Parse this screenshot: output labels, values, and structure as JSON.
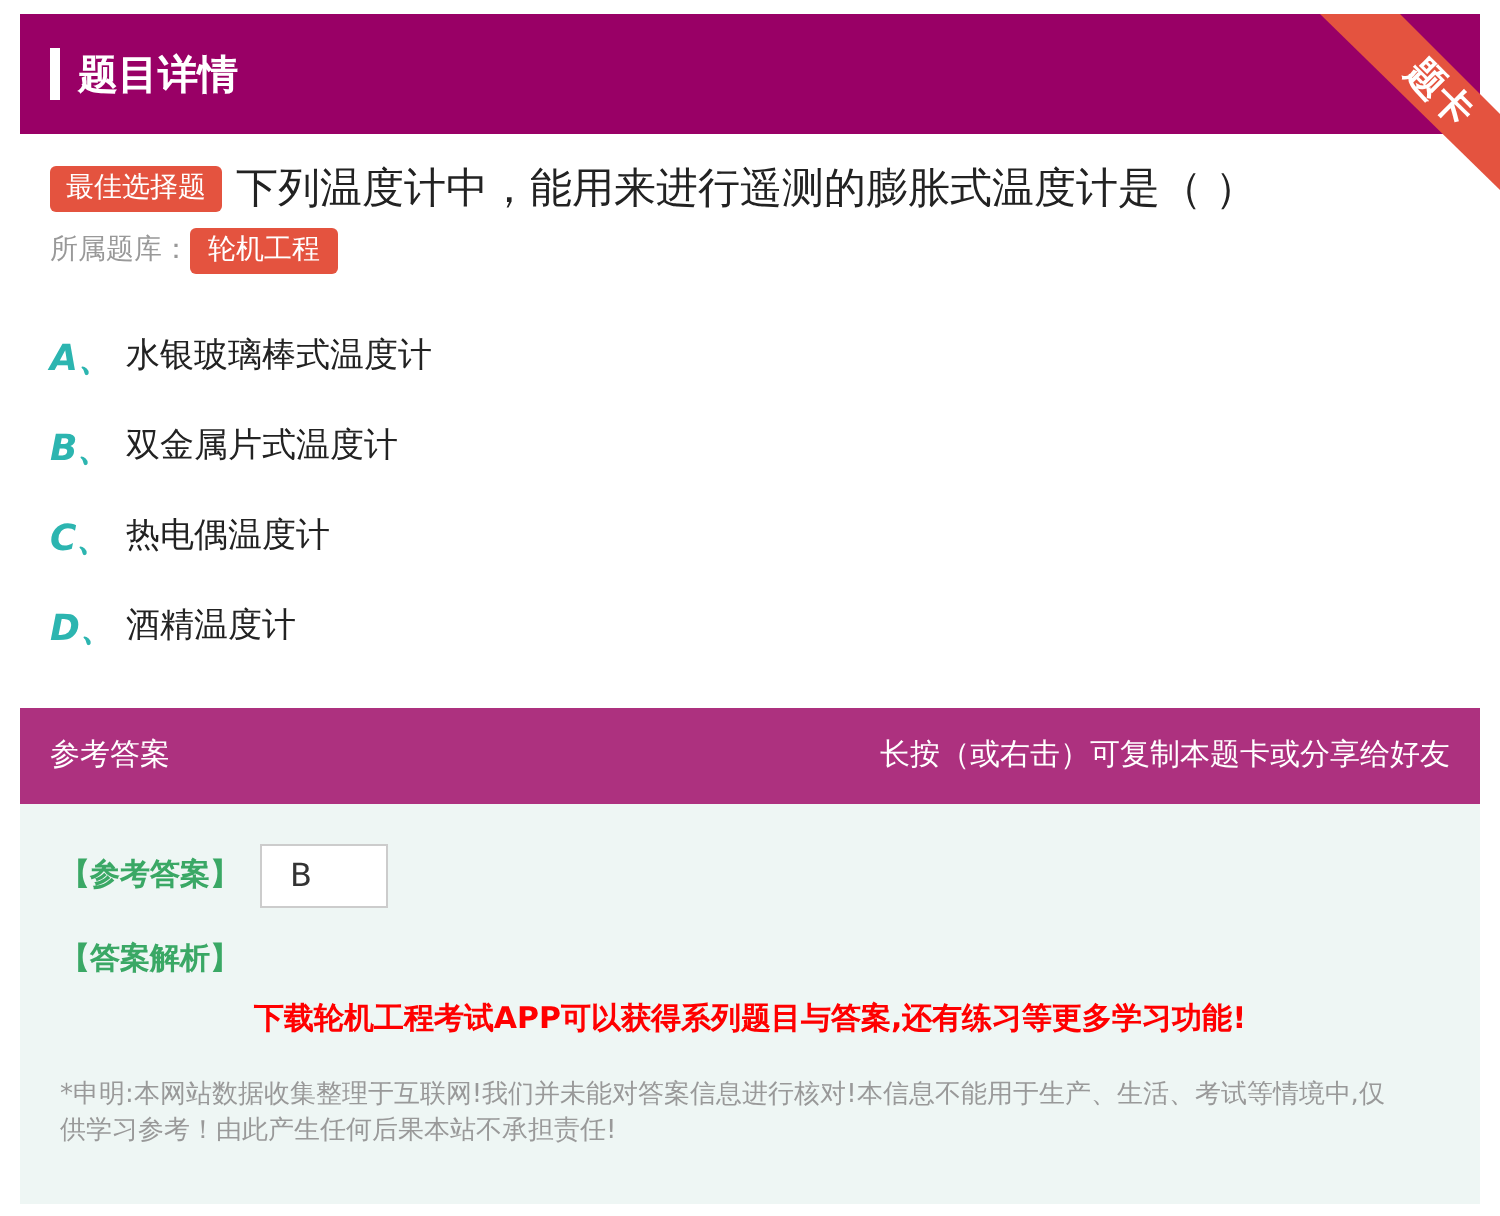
{
  "header": {
    "title": "题目详情",
    "corner_ribbon": "题卡"
  },
  "question": {
    "type_badge": "最佳选择题",
    "text": "下列温度计中，能用来进行遥测的膨胀式温度计是（ ）",
    "bank_label": "所属题库：",
    "bank_badge": "轮机工程"
  },
  "options": [
    {
      "label": "A、",
      "text": "水银玻璃棒式温度计"
    },
    {
      "label": "B、",
      "text": "双金属片式温度计"
    },
    {
      "label": "C、",
      "text": "热电偶温度计"
    },
    {
      "label": "D、",
      "text": "酒精温度计"
    }
  ],
  "answer_bar": {
    "title": "参考答案",
    "hint": "长按（或右击）可复制本题卡或分享给好友"
  },
  "answer": {
    "answer_label": "【参考答案】",
    "answer_value": "B",
    "analysis_label": "【答案解析】",
    "promo": "下载轮机工程考试APP可以获得系列题目与答案,还有练习等更多学习功能!",
    "disclaimer": "*申明:本网站数据收集整理于互联网!我们并未能对答案信息进行核对!本信息不能用于生产、生活、考试等情境中,仅供学习参考！由此产生任何后果本站不承担责任!"
  }
}
